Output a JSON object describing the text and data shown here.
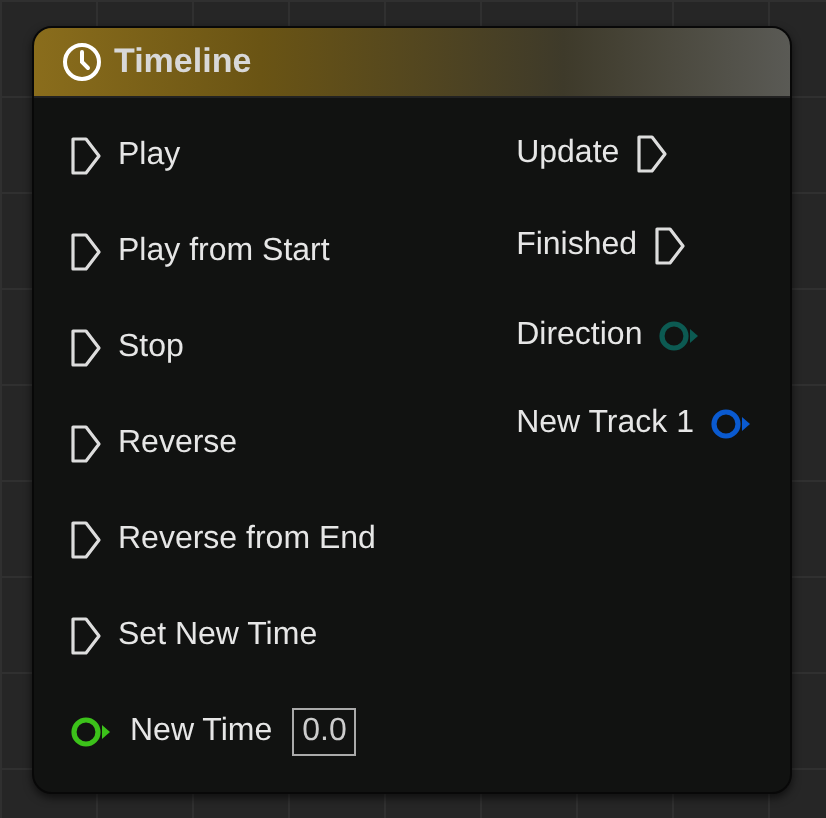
{
  "node": {
    "title": "Timeline"
  },
  "inputs": [
    {
      "kind": "exec",
      "label": "Play"
    },
    {
      "kind": "exec",
      "label": "Play from Start"
    },
    {
      "kind": "exec",
      "label": "Stop"
    },
    {
      "kind": "exec",
      "label": "Reverse"
    },
    {
      "kind": "exec",
      "label": "Reverse from End"
    },
    {
      "kind": "exec",
      "label": "Set New Time"
    },
    {
      "kind": "data",
      "label": "New Time",
      "color": "#3cc21a",
      "value": "0.0"
    }
  ],
  "outputs": [
    {
      "kind": "exec",
      "label": "Update"
    },
    {
      "kind": "exec",
      "label": "Finished"
    },
    {
      "kind": "data",
      "label": "Direction",
      "color": "#0c5a52"
    },
    {
      "kind": "data",
      "label": "New Track 1",
      "color": "#0a5ad0"
    }
  ]
}
